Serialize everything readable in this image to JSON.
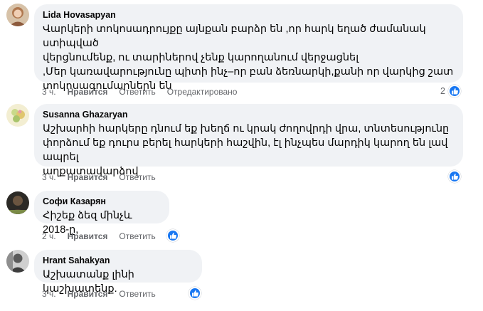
{
  "comments": [
    {
      "author": "Lida Hovasapyan",
      "text": "Վարկերի տոկոսադրույքը այնքան բարձր են ,որ հարկ եղած ժամանակ ստիպված\nվերցնումենք, ու տարիներով չենք կարողանում վերջացնել\n,Մեր կառավարությունը պիտի ինչ–որ բան ձեռնարկի,քանի որ վարկից շատ\nտոկոսագումարներն են",
      "time": "3 ч.",
      "like": "Нравится",
      "reply": "Ответить",
      "edited": "Отредактировано",
      "reaction_count": "2"
    },
    {
      "author": "Susanna Ghazaryan",
      "text": "Աշխարհի հարկերը դնում եք խեղճ ու կրակ ժողովրդի վրա, տնտեսությունը\nփորձում եք դուրս բերել հարկերի հաշվին, էլ ինչպես մարդիկ կարող են լավ ապրել\nաղքատավարձով",
      "time": "3 ч.",
      "like": "Нравится",
      "reply": "Ответить",
      "reaction_count": ""
    },
    {
      "author": "Софи Казарян",
      "text": "Հիշեք ձեզ մինչև 2018-ը,",
      "time": "2 ч.",
      "like": "Нравится",
      "reply": "Ответить",
      "reaction_count": ""
    },
    {
      "author": "Hrant Sahakyan",
      "text": "Աշխատանք լինի կաշխատենք.",
      "time": "3 ч.",
      "like": "Нравится",
      "reply": "Ответить",
      "reaction_count": ""
    }
  ],
  "icons": {
    "reaction": "thumbs-up-icon"
  },
  "colors": {
    "reaction": "#1877f2",
    "bubble": "#f0f2f5",
    "meta": "#65676b"
  }
}
